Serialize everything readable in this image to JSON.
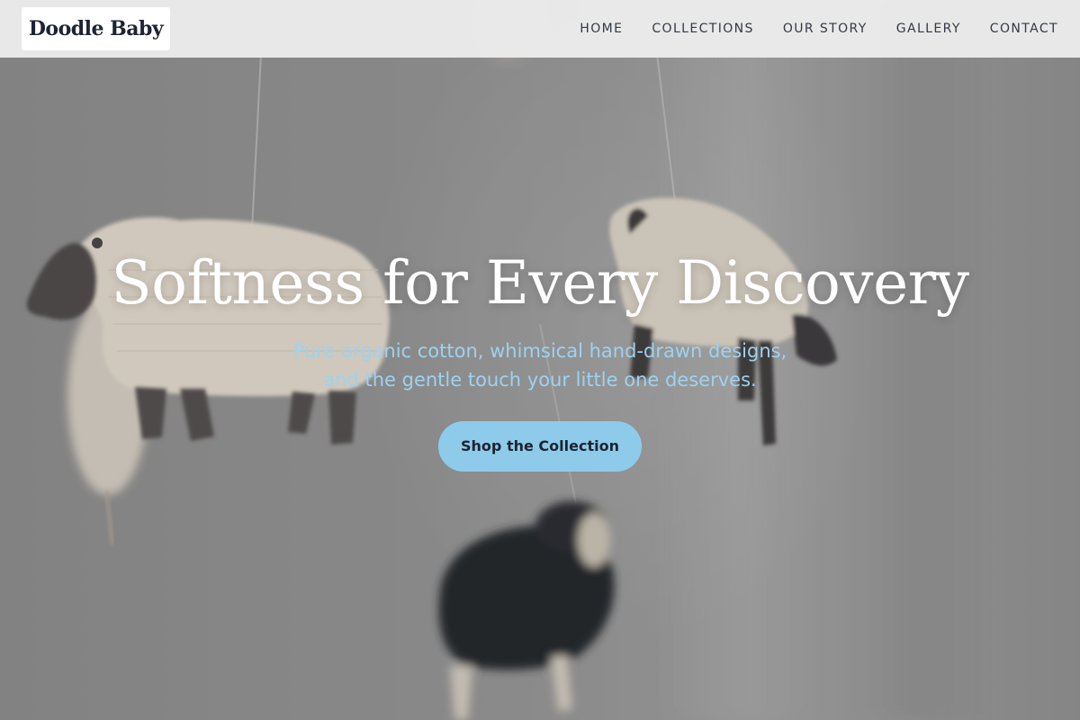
{
  "brand": {
    "name": "Doodle Baby"
  },
  "nav": {
    "items": [
      {
        "label": "HOME"
      },
      {
        "label": "COLLECTIONS"
      },
      {
        "label": "OUR STORY"
      },
      {
        "label": "GALLERY"
      },
      {
        "label": "CONTACT"
      }
    ]
  },
  "hero": {
    "title": "Softness for Every Discovery",
    "subtitle_line1": "Pure organic cotton, whimsical hand-drawn designs,",
    "subtitle_line2": "and the gentle touch your little one deserves.",
    "cta_label": "Shop the Collection",
    "background_image": "knitted-sheep-mobile-photo"
  },
  "colors": {
    "accent": "#8ecbea",
    "subtitle": "#9dd2f0",
    "title": "#ffffff",
    "nav_text": "#333a44",
    "logo_text": "#1d2433"
  }
}
